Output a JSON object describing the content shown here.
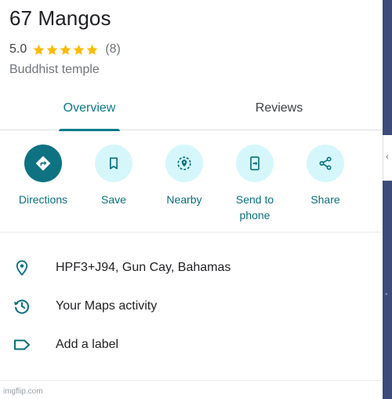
{
  "place": {
    "name": "67 Mangos",
    "rating": "5.0",
    "stars": 5,
    "review_count": "(8)",
    "category": "Buddhist temple"
  },
  "tabs": [
    {
      "label": "Overview",
      "active": true
    },
    {
      "label": "Reviews",
      "active": false
    }
  ],
  "actions": [
    {
      "label": "Directions",
      "icon": "directions-icon"
    },
    {
      "label": "Save",
      "icon": "bookmark-icon"
    },
    {
      "label": "Nearby",
      "icon": "nearby-icon"
    },
    {
      "label": "Send to phone",
      "icon": "send-to-phone-icon"
    },
    {
      "label": "Share",
      "icon": "share-icon"
    }
  ],
  "info": [
    {
      "text": "HPF3+J94, Gun Cay, Bahamas",
      "icon": "location-pin-icon"
    },
    {
      "text": "Your Maps activity",
      "icon": "history-icon"
    },
    {
      "text": "Add a label",
      "icon": "label-icon"
    }
  ],
  "watermark": "imgflip.com",
  "colors": {
    "accent": "#0a7a8a",
    "action_bg": "#d5f7fb",
    "primary_action_bg": "#0e7282",
    "star": "#fbbc04"
  }
}
